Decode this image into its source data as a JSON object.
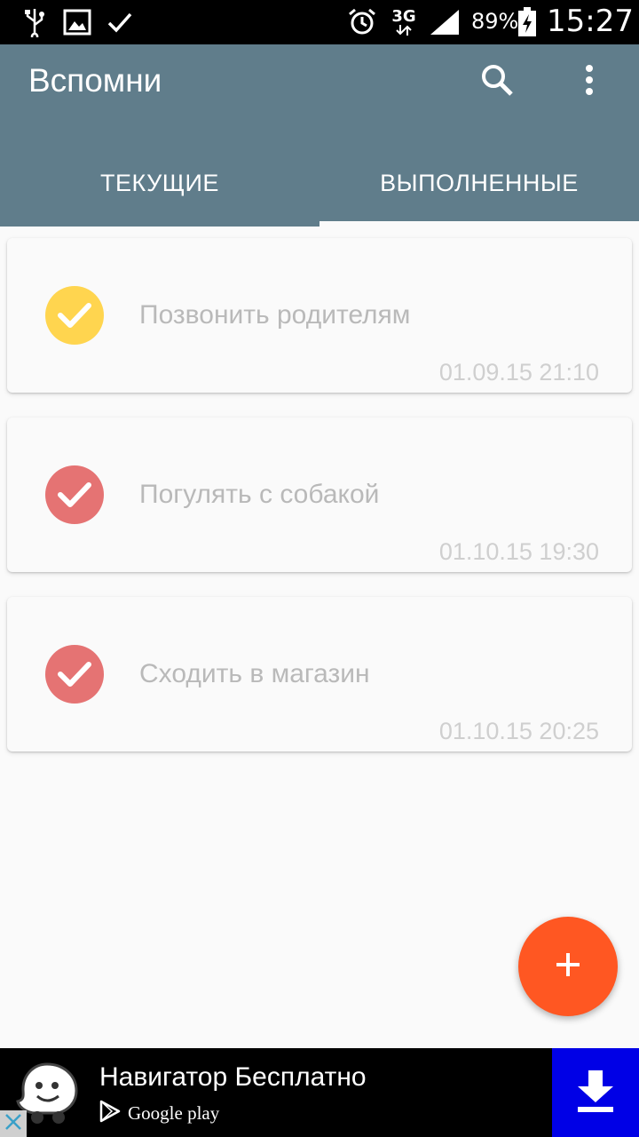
{
  "status_bar": {
    "battery_percent": "89%",
    "time": "15:27",
    "network": "3G",
    "icons": [
      "usb-icon",
      "image-icon",
      "check-icon",
      "alarm-icon",
      "network-3g-icon",
      "signal-icon",
      "battery-charging-icon"
    ]
  },
  "app_bar": {
    "title": "Вспомни",
    "icons": [
      "search-icon",
      "more-vert-icon"
    ],
    "color": "#607d8b"
  },
  "tabs": [
    {
      "label": "ТЕКУЩИЕ",
      "selected": false
    },
    {
      "label": "ВЫПОЛНЕННЫЕ",
      "selected": true
    }
  ],
  "tasks": [
    {
      "title": "Позвонить родителям",
      "date": "01.09.15 21:10",
      "color": "#ffd54f"
    },
    {
      "title": "Погулять с собакой",
      "date": "01.10.15 19:30",
      "color": "#e57373"
    },
    {
      "title": "Сходить в магазин",
      "date": "01.10.15 20:25",
      "color": "#e57373"
    }
  ],
  "fab": {
    "icon": "plus-icon",
    "color": "#ff5722"
  },
  "ad": {
    "title": "Навигатор Бесплатно",
    "store_label": "Google play",
    "icons": [
      "waze-logo-icon",
      "play-store-icon",
      "download-icon",
      "close-icon"
    ],
    "button_color": "#0000e6"
  }
}
